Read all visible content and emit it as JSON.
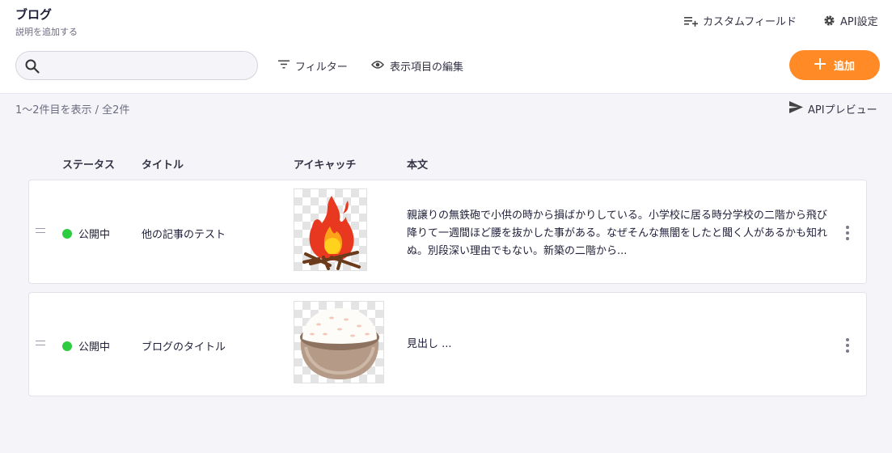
{
  "header": {
    "title": "ブログ",
    "description": "説明を追加する",
    "custom_field_label": "カスタムフィールド",
    "api_settings_label": "API設定"
  },
  "toolbar": {
    "search_placeholder": "",
    "filter_label": "フィルター",
    "columns_label": "表示項目の編集",
    "add_label": "追加"
  },
  "list": {
    "count_text": "1〜2件目を表示 / 全2件",
    "api_preview_label": "APIプレビュー",
    "columns": [
      "ステータス",
      "タイトル",
      "アイキャッチ",
      "本文"
    ],
    "rows": [
      {
        "status": "公開中",
        "title": "他の記事のテスト",
        "image": "campfire-illustration",
        "body": "親譲りの無鉄砲で小供の時から損ばかりしている。小学校に居る時分学校の二階から飛び降りて一週間ほど腰を抜かした事がある。なぜそんな無闇をしたと聞く人があるかも知れぬ。別段深い理由でもない。新築の二階から..."
      },
      {
        "status": "公開中",
        "title": "ブログのタイトル",
        "image": "rice-bowl-illustration",
        "body": "見出し ..."
      }
    ]
  },
  "colors": {
    "accent": "#ff8a26",
    "status_published": "#2ecc40",
    "background": "#f5f5f9"
  },
  "icons": [
    "custom-field-icon",
    "gear-icon",
    "search-icon",
    "filter-icon",
    "eye-icon",
    "plus-icon",
    "send-icon",
    "drag-handle-icon",
    "more-vertical-icon"
  ]
}
